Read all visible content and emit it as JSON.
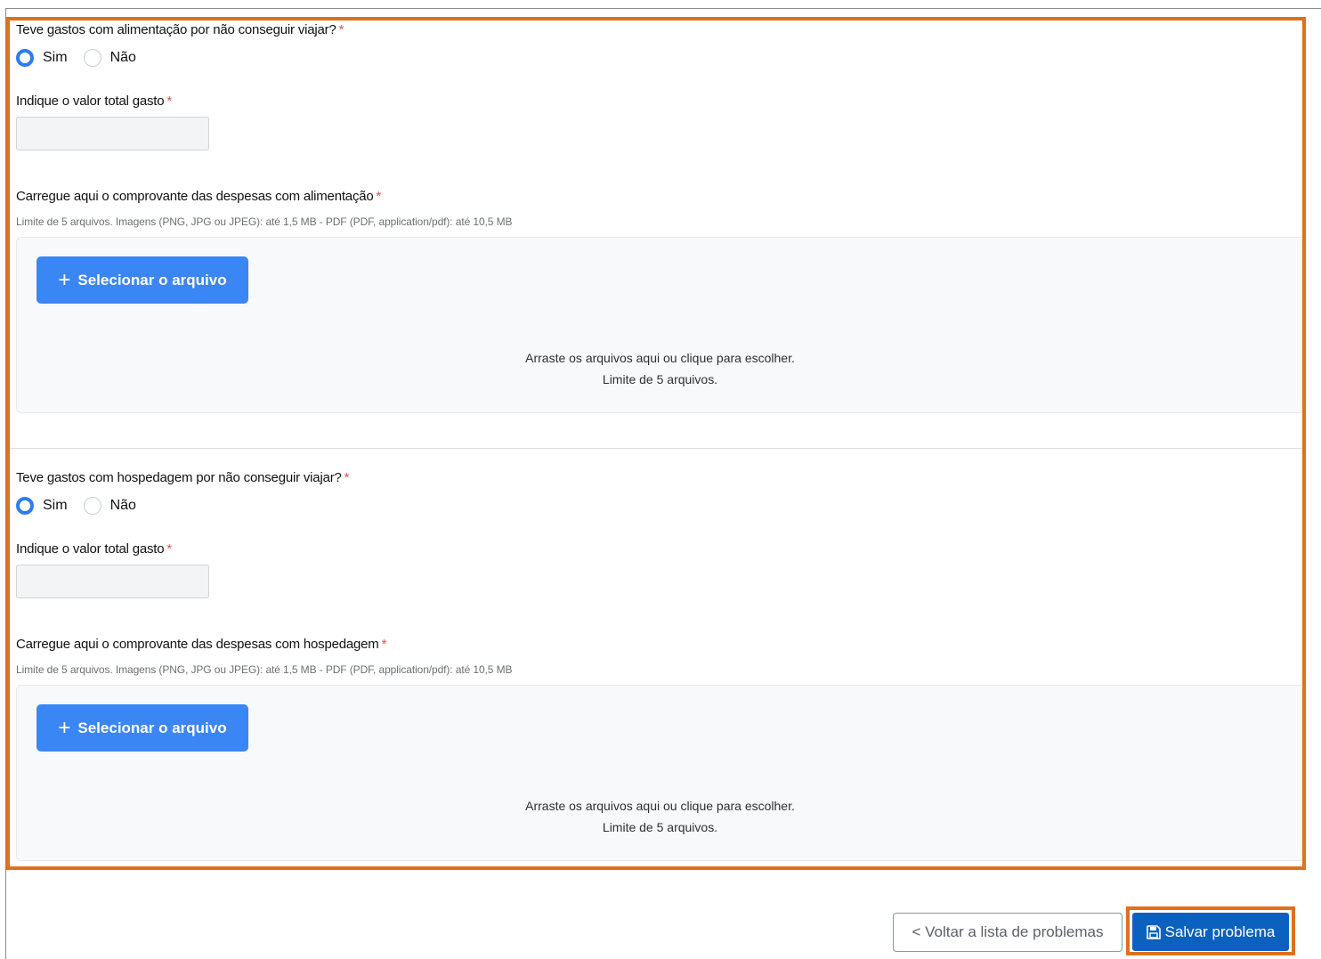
{
  "sections": [
    {
      "question": "Teve gastos com alimentação por não conseguir viajar?",
      "required_mark": "*",
      "options": [
        {
          "label": "Sim",
          "checked": true
        },
        {
          "label": "Não",
          "checked": false
        }
      ],
      "amount_label": "Indique o valor total gasto",
      "amount_value": "",
      "upload_title": "Carregue aqui o comprovante das despesas com alimentação",
      "upload_hint": "Limite de 5 arquivos. Imagens (PNG, JPG ou JPEG): até 1,5 MB - PDF (PDF, application/pdf): até 10,5 MB",
      "select_button": "Selecionar o arquivo",
      "drop_line1": "Arraste os arquivos aqui ou clique para escolher.",
      "drop_line2": "Limite de 5 arquivos."
    },
    {
      "question": "Teve gastos com hospedagem por não conseguir viajar?",
      "required_mark": "*",
      "options": [
        {
          "label": "Sim",
          "checked": true
        },
        {
          "label": "Não",
          "checked": false
        }
      ],
      "amount_label": "Indique o valor total gasto",
      "amount_value": "",
      "upload_title": "Carregue aqui o comprovante das despesas com hospedagem",
      "upload_hint": "Limite de 5 arquivos. Imagens (PNG, JPG ou JPEG): até 1,5 MB - PDF (PDF, application/pdf): até 10,5 MB",
      "select_button": "Selecionar o arquivo",
      "drop_line1": "Arraste os arquivos aqui ou clique para escolher.",
      "drop_line2": "Limite de 5 arquivos."
    }
  ],
  "footer": {
    "back_label": "< Voltar a lista de problemas",
    "save_label": "Salvar problema",
    "save_icon": "floppy-disk-icon"
  },
  "colors": {
    "highlight": "#e0701c",
    "primary_button": "#3b86f5",
    "save_button": "#0b61bd",
    "radio_checked": "#2f7bf5",
    "required": "#d9534f"
  }
}
